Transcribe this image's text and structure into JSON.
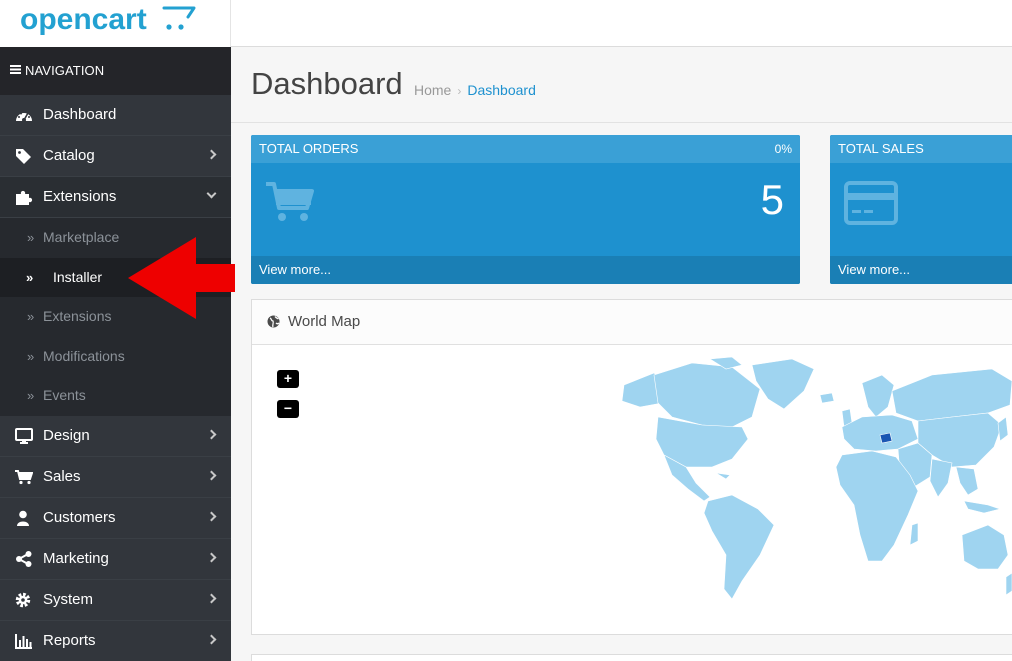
{
  "brand": {
    "name": "opencart",
    "color": "#23a1d1"
  },
  "nav": {
    "header": "NAVIGATION",
    "items": [
      {
        "label": "Dashboard",
        "icon": "dashboard-icon"
      },
      {
        "label": "Catalog",
        "icon": "tags-icon"
      },
      {
        "label": "Extensions",
        "icon": "puzzle-icon",
        "open": true,
        "children": [
          {
            "label": "Marketplace"
          },
          {
            "label": "Installer",
            "active": true
          },
          {
            "label": "Extensions"
          },
          {
            "label": "Modifications"
          },
          {
            "label": "Events"
          }
        ]
      },
      {
        "label": "Design",
        "icon": "desktop-icon"
      },
      {
        "label": "Sales",
        "icon": "cart-icon"
      },
      {
        "label": "Customers",
        "icon": "user-icon"
      },
      {
        "label": "Marketing",
        "icon": "share-icon"
      },
      {
        "label": "System",
        "icon": "gear-icon"
      },
      {
        "label": "Reports",
        "icon": "bar-chart-icon"
      }
    ]
  },
  "page": {
    "title": "Dashboard",
    "breadcrumb": {
      "home": "Home",
      "current": "Dashboard"
    }
  },
  "tiles": [
    {
      "title": "TOTAL ORDERS",
      "percent": "0%",
      "value": "5",
      "link": "View more...",
      "icon": "cart-icon"
    },
    {
      "title": "TOTAL SALES",
      "percent": "",
      "value": "",
      "link": "View more...",
      "icon": "credit-card-icon"
    }
  ],
  "map": {
    "title": "World Map",
    "zoom_in": "+",
    "zoom_out": "−",
    "land_color": "#9fd4f0",
    "highlight_color": "#1a56b3"
  },
  "colors": {
    "sidebar": "#2e3237",
    "tile_blue": "#1e91cf",
    "arrow": "#ee0000"
  }
}
